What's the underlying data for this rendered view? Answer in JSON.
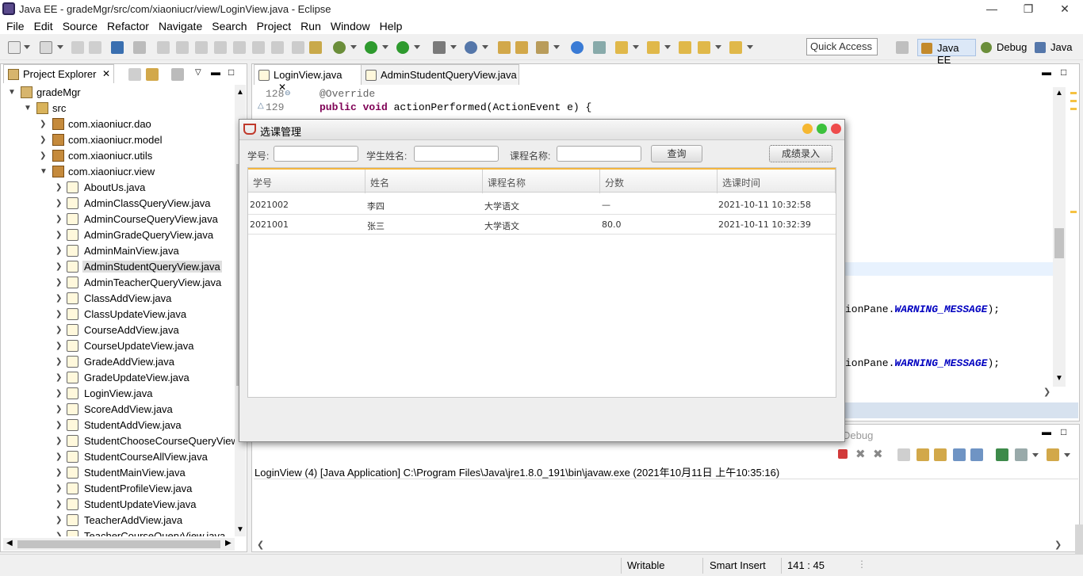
{
  "window": {
    "title": "Java EE - gradeMgr/src/com/xiaoniucr/view/LoginView.java - Eclipse"
  },
  "menu": [
    "File",
    "Edit",
    "Source",
    "Refactor",
    "Navigate",
    "Search",
    "Project",
    "Run",
    "Window",
    "Help"
  ],
  "quick_access": "Quick Access",
  "perspectives": [
    "Java EE",
    "Debug",
    "Java"
  ],
  "explorer": {
    "tab": "Project Explorer",
    "project": "gradeMgr",
    "src": "src",
    "packages": [
      "com.xiaoniucr.dao",
      "com.xiaoniucr.model",
      "com.xiaoniucr.utils",
      "com.xiaoniucr.view"
    ],
    "files": [
      "AboutUs.java",
      "AdminClassQueryView.java",
      "AdminCourseQueryView.java",
      "AdminGradeQueryView.java",
      "AdminMainView.java",
      "AdminStudentQueryView.java",
      "AdminTeacherQueryView.java",
      "ClassAddView.java",
      "ClassUpdateView.java",
      "CourseAddView.java",
      "CourseUpdateView.java",
      "GradeAddView.java",
      "GradeUpdateView.java",
      "LoginView.java",
      "ScoreAddView.java",
      "StudentAddView.java",
      "StudentChooseCourseQueryView",
      "StudentCourseAllView.java",
      "StudentMainView.java",
      "StudentProfileView.java",
      "StudentUpdateView.java",
      "TeacherAddView.java",
      "TeacherCourseQueryView.java"
    ]
  },
  "editor": {
    "tabs": [
      "LoginView.java",
      "AdminStudentQueryView.java"
    ],
    "line128": "128",
    "line129": "129",
    "code128": "@Override",
    "code129_kw": "public void",
    "code129_rest": " actionPerformed(ActionEvent e) {",
    "frag1_a": "ionPane.",
    "frag1_b": "WARNING_MESSAGE",
    "frag1_c": ");",
    "frag2_a": "ionPane.",
    "frag2_b": "WARNING_MESSAGE",
    "frag2_c": ");"
  },
  "console": {
    "debug_label": "Debug",
    "text": "LoginView (4) [Java Application] C:\\Program Files\\Java\\jre1.8.0_191\\bin\\javaw.exe (2021年10月11日 上午10:35:16)"
  },
  "status": {
    "writable": "Writable",
    "insert": "Smart Insert",
    "pos": "141 : 45"
  },
  "dialog": {
    "title": "选课管理",
    "student_id_label": "学号:",
    "student_name_label": "学生姓名:",
    "course_name_label": "课程名称:",
    "query_button": "查询",
    "grade_entry_button": "成绩录入",
    "columns": [
      "学号",
      "姓名",
      "课程名称",
      "分数",
      "选课时间"
    ],
    "rows": [
      [
        "2021002",
        "李四",
        "大学语文",
        "—",
        "2021-10-11 10:32:58"
      ],
      [
        "2021001",
        "张三",
        "大学语文",
        "80.0",
        "2021-10-11 10:32:39"
      ]
    ]
  }
}
